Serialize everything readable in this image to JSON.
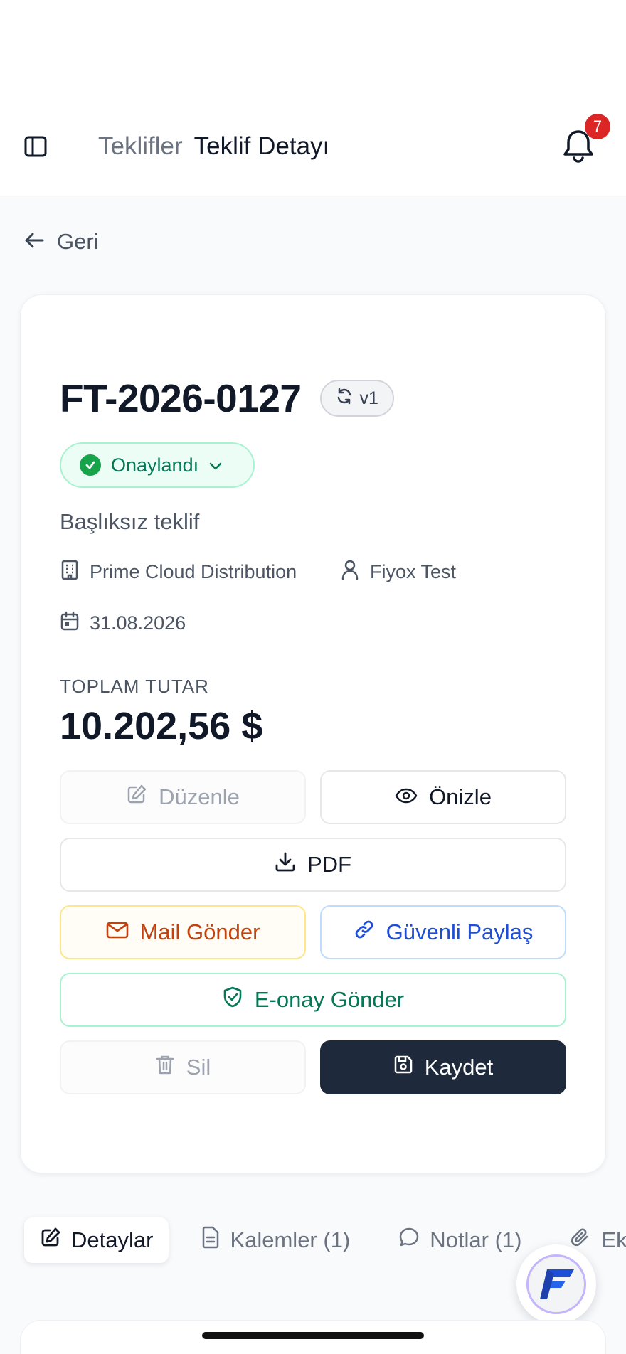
{
  "header": {
    "breadcrumb_parent": "Teklifler",
    "breadcrumb_current": "Teklif Detayı",
    "notification_count": "7",
    "sidebar_toggle_icon": "sidebar-panel-icon",
    "bell_icon": "bell-icon"
  },
  "back": {
    "label": "Geri",
    "icon": "arrow-left-icon"
  },
  "quote": {
    "code": "FT-2026-0127",
    "version": "v1",
    "status": "Onaylandı",
    "title": "Başlıksız teklif",
    "company": "Prime Cloud Distribution",
    "contact": "Fiyox Test",
    "date": "31.08.2026",
    "total_label": "TOPLAM TUTAR",
    "total_value": "10.202,56 $"
  },
  "actions": {
    "edit": "Düzenle",
    "preview": "Önizle",
    "pdf": "PDF",
    "mail": "Mail Gönder",
    "share": "Güvenli Paylaş",
    "eonay": "E-onay Gönder",
    "delete": "Sil",
    "save": "Kaydet"
  },
  "tabs": [
    {
      "label": "Detaylar",
      "icon": "pencil-square-icon",
      "active": true
    },
    {
      "label": "Kalemler (1)",
      "icon": "document-icon",
      "active": false
    },
    {
      "label": "Notlar (1)",
      "icon": "chat-bubble-icon",
      "active": false
    },
    {
      "label": "Ek",
      "icon": "paperclip-icon",
      "active": false
    }
  ],
  "colors": {
    "status_green": "#047857",
    "mail_orange": "#c2410c",
    "share_blue": "#1d4ed8",
    "save_dark": "#1e293b",
    "badge_red": "#dc2626"
  }
}
